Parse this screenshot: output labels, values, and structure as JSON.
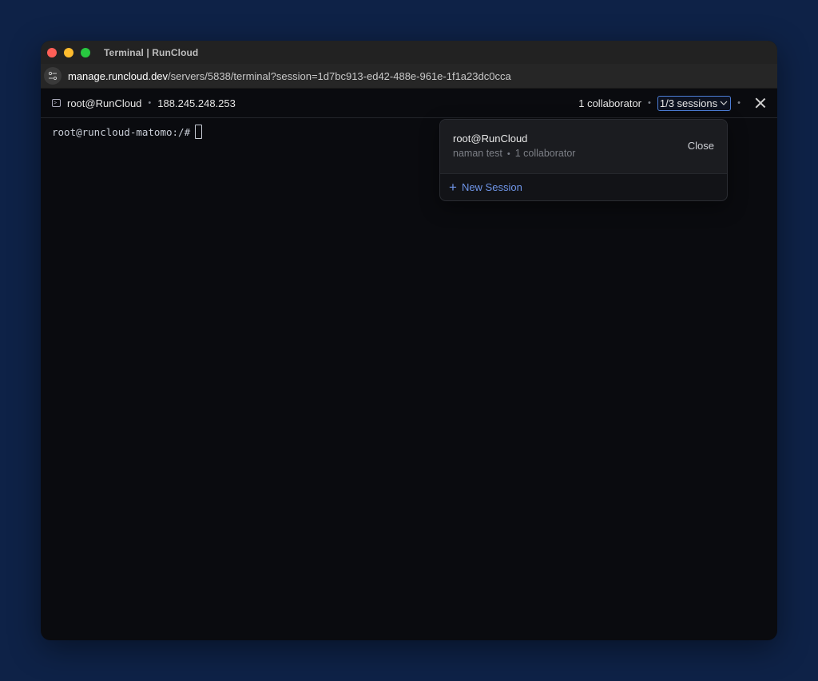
{
  "window": {
    "title": "Terminal | RunCloud"
  },
  "address": {
    "domain": "manage.runcloud.dev",
    "path": "/servers/5838/terminal?session=1d7bc913-ed42-488e-961e-1f1a23dc0cca"
  },
  "toolbar": {
    "user": "root@RunCloud",
    "separator": "•",
    "ip": "188.245.248.253",
    "collaborators": "1 collaborator",
    "sessions": "1/3 sessions",
    "chevron": "⌄"
  },
  "terminal": {
    "prompt": "root@runcloud-matomo:/#"
  },
  "dropdown": {
    "session_name": "root@RunCloud",
    "session_owner": "naman test",
    "session_collaborators": "1 collaborator",
    "close_label": "Close",
    "new_session_label": "New Session",
    "plus": "+"
  },
  "colors": {
    "background": "#0e2247",
    "accent": "#4c7dd6",
    "link": "#6f95e8"
  }
}
